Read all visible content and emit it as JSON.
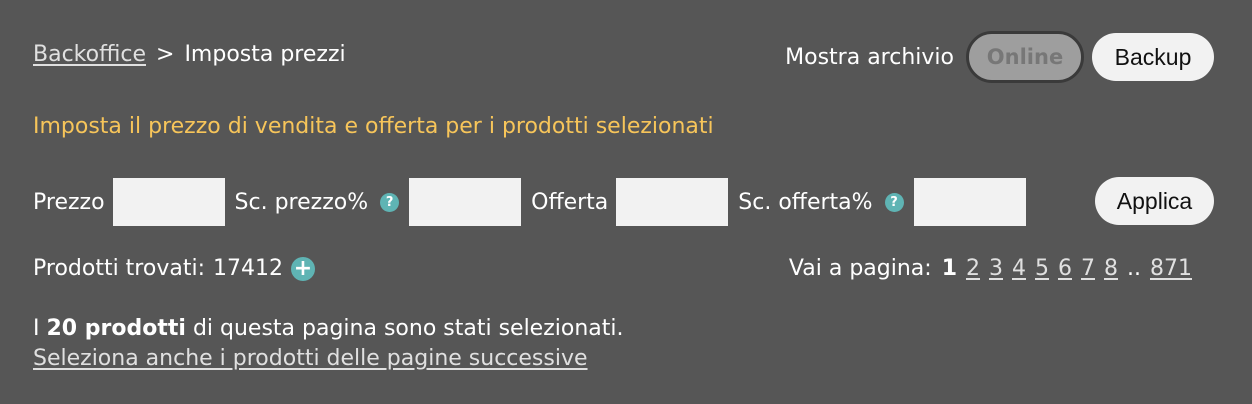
{
  "breadcrumb": {
    "root": "Backoffice",
    "separator": ">",
    "current": "Imposta prezzi"
  },
  "header": {
    "archive_label": "Mostra archivio",
    "online_toggle": "Online",
    "backup_button": "Backup"
  },
  "subtitle": "Imposta il prezzo di vendita e offerta per i prodotti selezionati",
  "pricing": {
    "price_label": "Prezzo",
    "price_discount_label": "Sc. prezzo%",
    "offer_label": "Offerta",
    "offer_discount_label": "Sc. offerta%",
    "help_glyph": "?",
    "apply_button": "Applica",
    "price_value": "",
    "price_discount_value": "",
    "offer_value": "",
    "offer_discount_value": ""
  },
  "results": {
    "label": "Prodotti trovati:",
    "count": "17412",
    "plus_glyph": "+"
  },
  "pager": {
    "label": "Vai a pagina:",
    "current": "1",
    "pages": [
      "2",
      "3",
      "4",
      "5",
      "6",
      "7",
      "8"
    ],
    "ellipsis": "..",
    "last": "871"
  },
  "selection": {
    "prefix": "I",
    "count_text": "20 prodotti",
    "suffix": "di questa pagina sono stati selezionati.",
    "select_more_link": "Seleziona anche i prodotti delle pagine successive"
  },
  "colors": {
    "background": "#565656",
    "accent_text": "#f7c55a",
    "icon_teal": "#5fb4b4"
  }
}
